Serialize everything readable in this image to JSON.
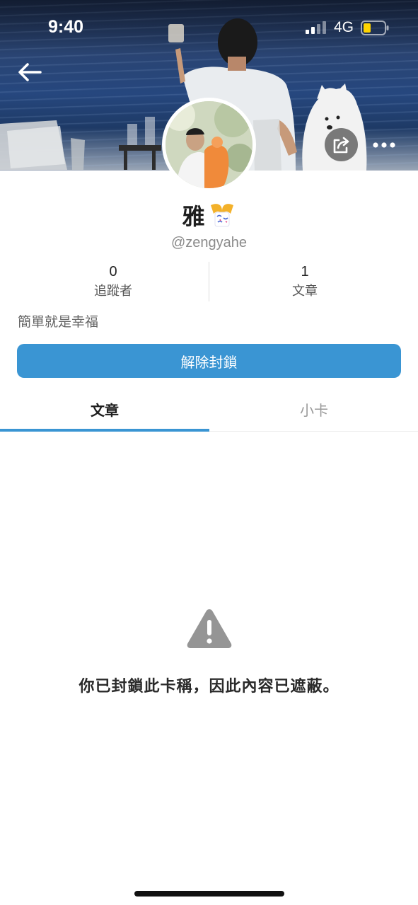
{
  "status_bar": {
    "time": "9:40",
    "network": "4G",
    "battery_color": "#ffd400"
  },
  "profile": {
    "name": "雅",
    "handle": "@zengyahe",
    "bio": "簡單就是幸福"
  },
  "stats": [
    {
      "count": "0",
      "label": "追蹤者"
    },
    {
      "count": "1",
      "label": "文章"
    }
  ],
  "unblock_button": {
    "label": "解除封鎖",
    "color": "#3a95d3"
  },
  "tabs": [
    {
      "label": "文章",
      "active": true
    },
    {
      "label": "小卡",
      "active": false
    }
  ],
  "blocked_message": "你已封鎖此卡稱，因此內容已遮蔽。",
  "icons": [
    "back-arrow-icon",
    "share-icon",
    "more-icon",
    "warning-icon",
    "party-popper-emoji"
  ]
}
